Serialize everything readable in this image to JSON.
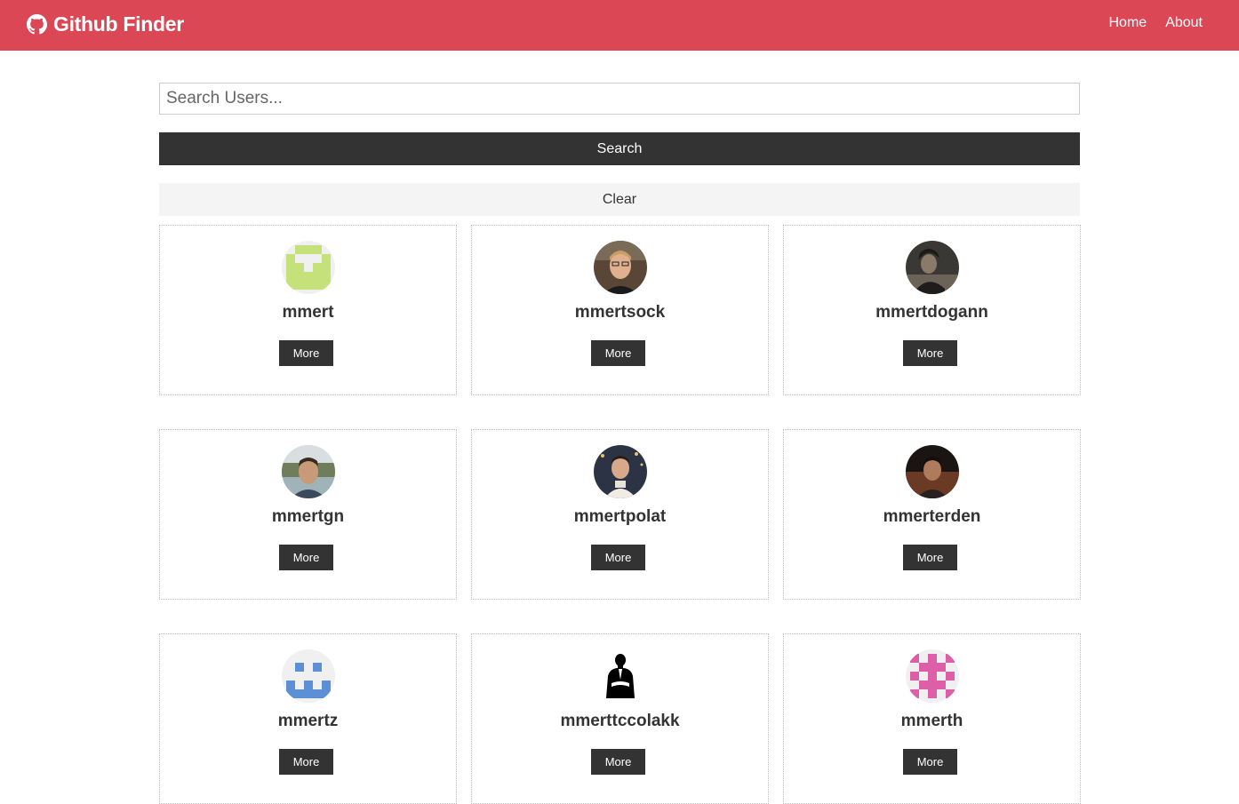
{
  "navbar": {
    "brand": "Github Finder",
    "brand_icon": "github-icon",
    "links": {
      "home": "Home",
      "about": "About"
    },
    "color": "#dc4755"
  },
  "search": {
    "placeholder": "Search Users...",
    "value": "",
    "search_label": "Search",
    "clear_label": "Clear"
  },
  "users": [
    {
      "login": "mmert",
      "more_label": "More",
      "avatar": "identicon-green"
    },
    {
      "login": "mmertsock",
      "more_label": "More",
      "avatar": "photo-man-glasses"
    },
    {
      "login": "mmertdogann",
      "more_label": "More",
      "avatar": "photo-dark-portrait"
    },
    {
      "login": "mmertgn",
      "more_label": "More",
      "avatar": "photo-man-outdoor"
    },
    {
      "login": "mmertpolat",
      "more_label": "More",
      "avatar": "photo-man-night"
    },
    {
      "login": "mmerterden",
      "more_label": "More",
      "avatar": "photo-man-dark"
    },
    {
      "login": "mmertz",
      "more_label": "More",
      "avatar": "identicon-blue"
    },
    {
      "login": "mmerttccolakk",
      "more_label": "More",
      "avatar": "silhouette-businessman"
    },
    {
      "login": "mmerth",
      "more_label": "More",
      "avatar": "identicon-pink"
    }
  ]
}
